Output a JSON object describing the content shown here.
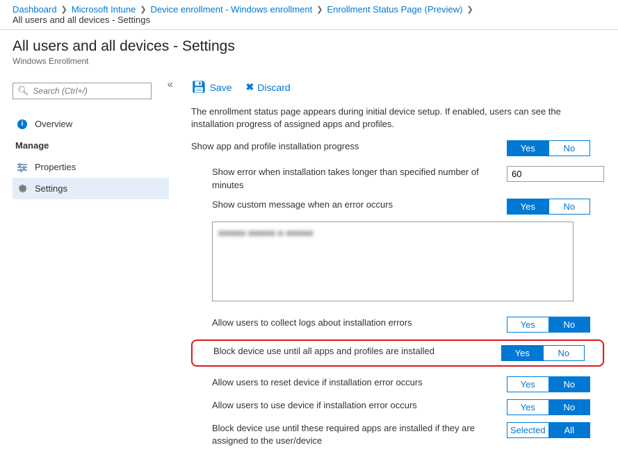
{
  "breadcrumb": {
    "items": [
      {
        "label": "Dashboard"
      },
      {
        "label": "Microsoft Intune"
      },
      {
        "label": "Device enrollment - Windows enrollment"
      },
      {
        "label": "Enrollment Status Page (Preview)"
      }
    ],
    "current": "All users and all devices - Settings"
  },
  "header": {
    "title": "All users and all devices - Settings",
    "subtitle": "Windows Enrollment"
  },
  "sidebar": {
    "search_placeholder": "Search (Ctrl+/)",
    "overview": "Overview",
    "manage_label": "Manage",
    "properties": "Properties",
    "settings": "Settings"
  },
  "toolbar": {
    "save": "Save",
    "discard": "Discard"
  },
  "main": {
    "description": "The enrollment status page appears during initial device setup. If enabled, users can see the installation progress of assigned apps and profiles.",
    "show_progress": {
      "label": "Show app and profile installation progress",
      "yes": "Yes",
      "no": "No",
      "value": "Yes"
    },
    "timeout": {
      "label": "Show error when installation takes longer than specified number of minutes",
      "value": "60"
    },
    "custom_msg": {
      "label": "Show custom message when an error occurs",
      "yes": "Yes",
      "no": "No",
      "value": "Yes",
      "text_blur": "■■■■■ ■■■■■ ■ ■■■■■"
    },
    "collect_logs": {
      "label": "Allow users to collect logs about installation errors",
      "yes": "Yes",
      "no": "No",
      "value": "No"
    },
    "block_device": {
      "label": "Block device use until all apps and profiles are installed",
      "yes": "Yes",
      "no": "No",
      "value": "Yes"
    },
    "allow_reset": {
      "label": "Allow users to reset device if installation error occurs",
      "yes": "Yes",
      "no": "No",
      "value": "No"
    },
    "allow_use": {
      "label": "Allow users to use device if installation error occurs",
      "yes": "Yes",
      "no": "No",
      "value": "No"
    },
    "block_required": {
      "label": "Block device use until these required apps are installed if they are assigned to the user/device",
      "selected": "Selected",
      "all": "All",
      "value": "All"
    }
  }
}
